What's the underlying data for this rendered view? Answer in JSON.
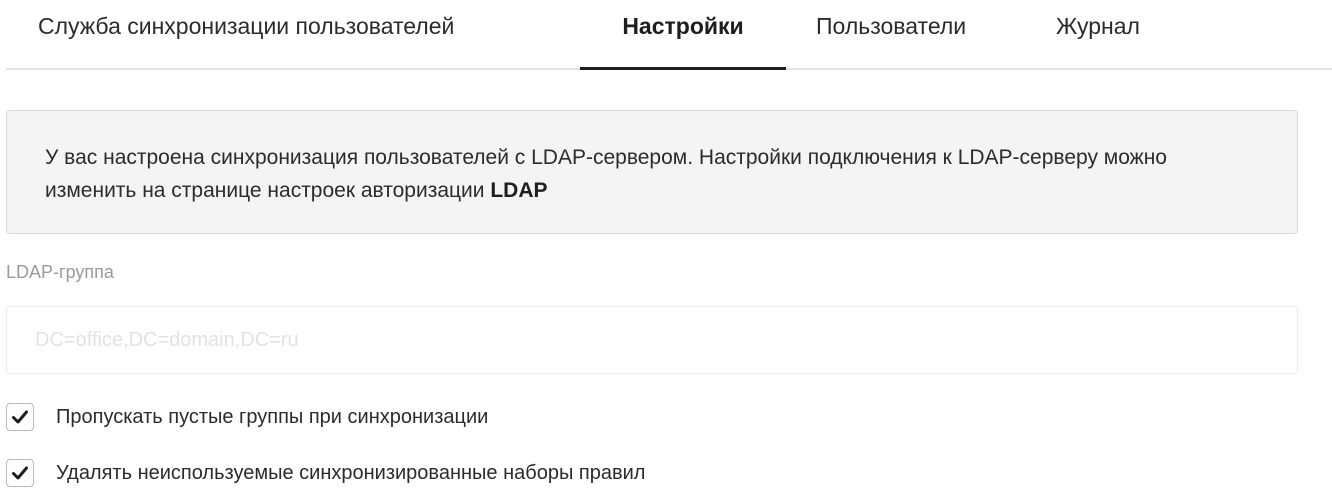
{
  "tabs": [
    {
      "label": "Служба синхронизации пользователей",
      "active": false
    },
    {
      "label": "Настройки",
      "active": true
    },
    {
      "label": "Пользователи",
      "active": false
    },
    {
      "label": "Журнал",
      "active": false
    }
  ],
  "notice": {
    "text": "У вас настроена синхронизация пользователей с LDAP-сервером. Настройки подключения к LDAP-серверу можно изменить на странице настроек авторизации ",
    "link_text": "LDAP"
  },
  "ldap_group": {
    "label": "LDAP-группа",
    "value": "",
    "placeholder": "DC=office,DC=domain,DC=ru"
  },
  "options": [
    {
      "label": "Пропускать пустые группы при синхронизации",
      "checked": true,
      "icon": "checkmark-icon"
    },
    {
      "label": "Удалять неиспользуемые синхронизированные наборы правил",
      "checked": true,
      "icon": "checkmark-icon"
    }
  ],
  "colors": {
    "active_tab_underline": "#1e1e1e",
    "notice_background": "#f4f4f4",
    "label_gray": "#9a9a9a"
  }
}
